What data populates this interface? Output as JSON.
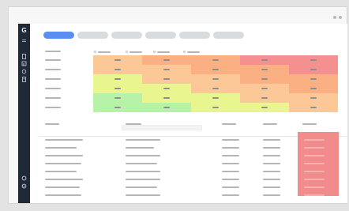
{
  "window": {
    "dots": [
      "dot-1",
      "dot-2"
    ]
  },
  "colors": {
    "accent": "#5b8ef2",
    "sidebar": "#1f2a38",
    "heat_orange_light": "#fcc897",
    "heat_orange": "#fbb083",
    "heat_red": "#f49090",
    "heat_yellow": "#e9f58e",
    "heat_green": "#b6f2a8",
    "highlight": "#f28c8c"
  },
  "sidebar": {
    "logo": "G",
    "items": [
      "file-icon",
      "chart-icon",
      "refresh-icon",
      "doc-icon"
    ],
    "bottom_items": [
      "settings-icon",
      "user-icon"
    ]
  },
  "toolbar": {
    "tabs": [
      {
        "name": "tab-1",
        "active": true
      },
      {
        "name": "tab-2",
        "active": false
      },
      {
        "name": "tab-3",
        "active": false
      },
      {
        "name": "tab-4",
        "active": false
      },
      {
        "name": "tab-5",
        "active": false
      },
      {
        "name": "tab-6",
        "active": false
      }
    ]
  },
  "heatmap": {
    "rows": [
      [
        "heat_orange_light",
        "heat_orange",
        "heat_orange",
        "heat_red",
        "heat_red"
      ],
      [
        "heat_orange_light",
        "heat_orange_light",
        "heat_orange",
        "heat_orange",
        "heat_red"
      ],
      [
        "heat_yellow",
        "heat_orange_light",
        "heat_orange_light",
        "heat_orange",
        "heat_orange"
      ],
      [
        "heat_yellow",
        "heat_yellow",
        "heat_orange_light",
        "heat_orange_light",
        "heat_orange"
      ],
      [
        "heat_green",
        "heat_yellow",
        "heat_yellow",
        "heat_orange_light",
        "heat_orange_light"
      ],
      [
        "heat_green",
        "heat_green",
        "heat_yellow",
        "heat_yellow",
        "heat_orange_light"
      ]
    ]
  },
  "table": {
    "row_count": 8
  }
}
